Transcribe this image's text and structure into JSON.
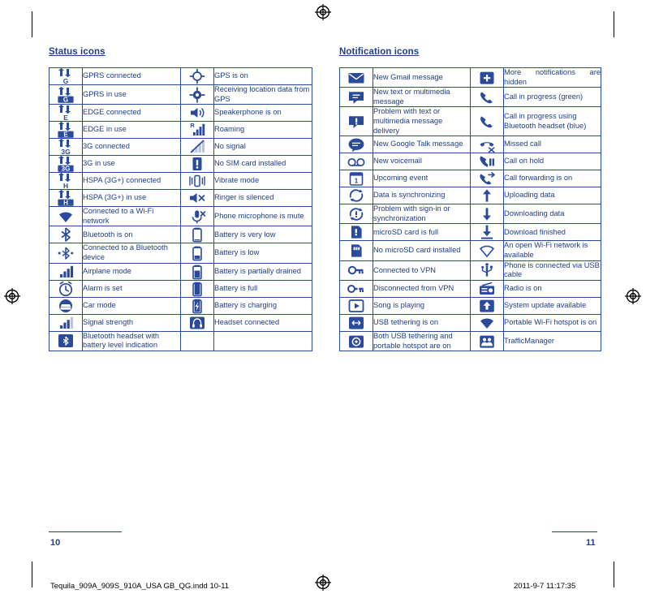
{
  "headings": {
    "status": "Status icons",
    "notification": "Notification icons"
  },
  "status_rows": [
    {
      "left_icon": "gprs-connected-icon",
      "left_label": "GPRS connected",
      "right_icon": "gps-on-icon",
      "right_label": "GPS is on"
    },
    {
      "left_icon": "gprs-in-use-icon",
      "left_label": "GPRS in use",
      "right_icon": "gps-receiving-icon",
      "right_label": "Receiving location data from GPS"
    },
    {
      "left_icon": "edge-connected-icon",
      "left_label": "EDGE connected",
      "right_icon": "speakerphone-on-icon",
      "right_label": "Speakerphone is on"
    },
    {
      "left_icon": "edge-in-use-icon",
      "left_label": "EDGE in use",
      "right_icon": "roaming-icon",
      "right_label": "Roaming"
    },
    {
      "left_icon": "3g-connected-icon",
      "left_label": "3G connected",
      "right_icon": "no-signal-icon",
      "right_label": "No signal"
    },
    {
      "left_icon": "3g-in-use-icon",
      "left_label": "3G in use",
      "right_icon": "no-sim-card-icon",
      "right_label": "No SIM card installed"
    },
    {
      "left_icon": "hspa-connected-icon",
      "left_label": "HSPA (3G+) connected",
      "right_icon": "vibrate-mode-icon",
      "right_label": "Vibrate mode"
    },
    {
      "left_icon": "hspa-in-use-icon",
      "left_label": "HSPA (3G+) in use",
      "right_icon": "ringer-silenced-icon",
      "right_label": "Ringer is silenced"
    },
    {
      "left_icon": "wifi-connected-icon",
      "left_label": "Connected to a Wi-Fi network",
      "right_icon": "microphone-mute-icon",
      "right_label": "Phone microphone is mute"
    },
    {
      "left_icon": "bluetooth-on-icon",
      "left_label": "Bluetooth is on",
      "right_icon": "battery-very-low-icon",
      "right_label": "Battery is very low"
    },
    {
      "left_icon": "bluetooth-connected-icon",
      "left_label": "Connected to a Bluetooth device",
      "right_icon": "battery-low-icon",
      "right_label": "Battery is low"
    },
    {
      "left_icon": "airplane-mode-icon",
      "left_label": "Airplane mode",
      "right_icon": "battery-partially-drained-icon",
      "right_label": "Battery is partially drained"
    },
    {
      "left_icon": "alarm-set-icon",
      "left_label": "Alarm is set",
      "right_icon": "battery-full-icon",
      "right_label": "Battery is full"
    },
    {
      "left_icon": "car-mode-icon",
      "left_label": "Car mode",
      "right_icon": "battery-charging-icon",
      "right_label": "Battery is charging"
    },
    {
      "left_icon": "signal-strength-icon",
      "left_label": "Signal strength",
      "right_icon": "headset-connected-icon",
      "right_label": "Headset connected"
    },
    {
      "left_icon": "bluetooth-headset-battery-icon",
      "left_label": "Bluetooth headset with battery level indication",
      "right_icon": "",
      "right_label": ""
    }
  ],
  "notification_rows": [
    {
      "left_icon": "new-gmail-icon",
      "left_label": "New Gmail message",
      "right_icon": "more-notifications-icon",
      "right_label": "More notifications are hidden",
      "right_justify": true
    },
    {
      "left_icon": "new-text-message-icon",
      "left_label": "New text or multimedia message",
      "right_icon": "call-in-progress-green-icon",
      "right_label": "Call in progress (green)"
    },
    {
      "left_icon": "message-problem-icon",
      "left_label": "Problem with text or multimedia message delivery",
      "right_icon": "call-bluetooth-headset-icon",
      "right_label": "Call in progress using Bluetooth headset (blue)"
    },
    {
      "left_icon": "google-talk-icon",
      "left_label": "New Google Talk message",
      "right_icon": "missed-call-icon",
      "right_label": "Missed call"
    },
    {
      "left_icon": "voicemail-icon",
      "left_label": "New voicemail",
      "right_icon": "call-on-hold-icon",
      "right_label": "Call on hold"
    },
    {
      "left_icon": "upcoming-event-icon",
      "left_label": "Upcoming event",
      "right_icon": "call-forwarding-icon",
      "right_label": "Call forwarding is on"
    },
    {
      "left_icon": "data-syncing-icon",
      "left_label": "Data is synchronizing",
      "right_icon": "uploading-icon",
      "right_label": "Uploading data"
    },
    {
      "left_icon": "sync-problem-icon",
      "left_label": "Problem with sign-in or synchronization",
      "right_icon": "downloading-icon",
      "right_label": "Downloading data"
    },
    {
      "left_icon": "sdcard-full-icon",
      "left_label": "microSD card is full",
      "right_icon": "download-finished-icon",
      "right_label": "Download finished"
    },
    {
      "left_icon": "no-sdcard-icon",
      "left_label": "No microSD card installed",
      "right_icon": "open-wifi-available-icon",
      "right_label": "An open Wi-Fi network is available"
    },
    {
      "left_icon": "vpn-connected-icon",
      "left_label": "Connected to VPN",
      "right_icon": "usb-cable-icon",
      "right_label": "Phone is connected via USB cable"
    },
    {
      "left_icon": "vpn-disconnected-icon",
      "left_label": "Disconnected from VPN",
      "right_icon": "radio-on-icon",
      "right_label": "Radio is on"
    },
    {
      "left_icon": "song-playing-icon",
      "left_label": "Song is playing",
      "right_icon": "system-update-icon",
      "right_label": "System update available"
    },
    {
      "left_icon": "usb-tethering-icon",
      "left_label": "USB tethering is on",
      "right_icon": "portable-hotspot-icon",
      "right_label": "Portable Wi-Fi hotspot is on"
    },
    {
      "left_icon": "usb-tethering-and-hotspot-icon",
      "left_label": "Both USB tethering and portable hotspot are on",
      "right_icon": "traffic-manager-icon",
      "right_label": "TrafficManager"
    }
  ],
  "footer": {
    "page_left": "10",
    "page_right": "11",
    "imprint_left": "Tequila_909A_909S_910A_USA GB_QG.indd   10-11",
    "imprint_right": "2011-9-7   11:17:35"
  },
  "colors": {
    "ink": "#1f3d8c",
    "rule": "#2a4a9c",
    "black": "#000000"
  }
}
